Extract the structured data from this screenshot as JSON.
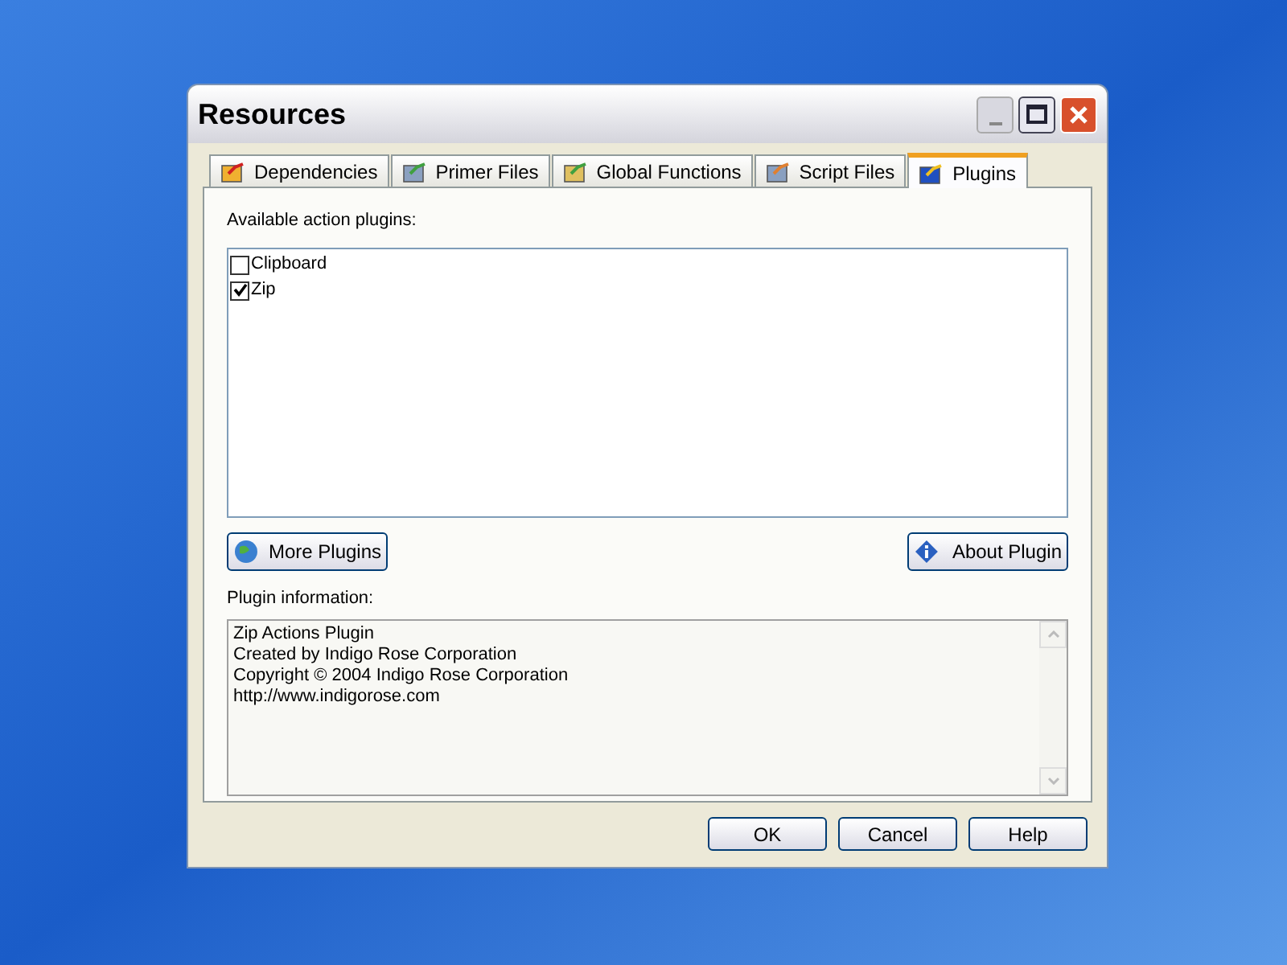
{
  "window": {
    "title": "Resources"
  },
  "tabs": [
    {
      "label": "Dependencies",
      "selected": false,
      "kind": "deps"
    },
    {
      "label": "Primer Files",
      "selected": false,
      "kind": "primer"
    },
    {
      "label": "Global Functions",
      "selected": false,
      "kind": "global"
    },
    {
      "label": "Script Files",
      "selected": false,
      "kind": "script"
    },
    {
      "label": "Plugins",
      "selected": true,
      "kind": "plugin"
    }
  ],
  "plugins": {
    "label": "Available action plugins:",
    "items": [
      {
        "name": "Clipboard",
        "checked": false
      },
      {
        "name": "Zip",
        "checked": true
      }
    ]
  },
  "more_button": "More Plugins",
  "about_button": "About Plugin",
  "info": {
    "label": "Plugin information:",
    "lines": [
      "Zip Actions Plugin",
      "Created by Indigo Rose Corporation",
      "Copyright © 2004 Indigo Rose Corporation",
      "http://www.indigorose.com"
    ]
  },
  "buttons": [
    "OK",
    "Cancel",
    "Help"
  ]
}
